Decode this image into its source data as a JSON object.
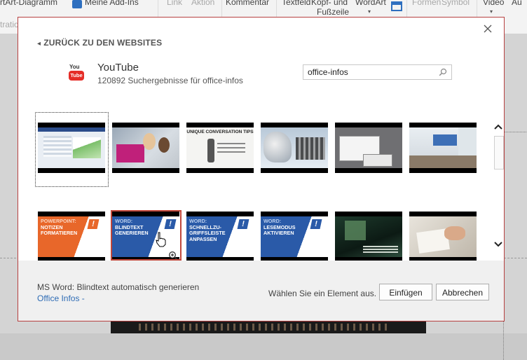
{
  "ribbon": {
    "items": [
      "rtArt-Diagramm",
      "Meine Add-Ins",
      "Link",
      "Aktion",
      "Kommentar",
      "Textfeld",
      "Kopf- und",
      "WordArt",
      "Fußzeile",
      "Formen",
      "Symbol",
      "Video",
      "Au"
    ],
    "left_label": "tratio"
  },
  "dialog": {
    "back_label": "ZURÜCK ZU DEN WEBSITES",
    "source": {
      "name": "YouTube",
      "results": "120892 Suchergebnisse für office-infos",
      "logo_top": "You",
      "logo_bottom": "Tube"
    },
    "search": {
      "value": "office-infos"
    },
    "row1": [
      {
        "name": "video-thumb-1-1",
        "icon": "spreadsheet-screenshot"
      },
      {
        "name": "video-thumb-1-2",
        "icon": "people-at-computer"
      },
      {
        "name": "video-thumb-1-3",
        "icon": "whiteboard-drawing",
        "caption": "UNIQUE CONVERSATION TIPS"
      },
      {
        "name": "video-thumb-1-4",
        "icon": "mac-desktop"
      },
      {
        "name": "video-thumb-1-5",
        "icon": "software-window"
      },
      {
        "name": "video-thumb-1-6",
        "icon": "office-room"
      }
    ],
    "row2": [
      {
        "name": "video-thumb-2-1",
        "lines": [
          "POWERPOINT:",
          "NOTIZEN",
          "FORMATIEREN"
        ],
        "color": "#e8672a"
      },
      {
        "name": "video-thumb-2-2",
        "lines": [
          "WORD:",
          "BLINDTEXT",
          "GENERIEREN"
        ],
        "color": "#2a5aa8"
      },
      {
        "name": "video-thumb-2-3",
        "lines": [
          "WORD:",
          "SCHNELLZU-",
          "GRIFFSLEISTE",
          "ANPASSEN"
        ],
        "color": "#2a5aa8"
      },
      {
        "name": "video-thumb-2-4",
        "lines": [
          "WORD:",
          "LESEMODUS",
          "AKTIVIEREN"
        ],
        "color": "#2a5aa8"
      },
      {
        "name": "video-thumb-2-5",
        "icon": "dark-lab-photo"
      },
      {
        "name": "video-thumb-2-6",
        "icon": "hands-writing-photo"
      }
    ],
    "footer": {
      "selected_title": "MS Word: Blindtext automatisch generieren",
      "selected_author": "Office Infos -",
      "hint": "Wählen Sie ein Element aus.",
      "insert_label": "Einfügen",
      "cancel_label": "Abbrechen"
    },
    "colors": {
      "accent_border": "#b74040",
      "link": "#2f6cb5",
      "youtube_red": "#e52d27"
    }
  }
}
